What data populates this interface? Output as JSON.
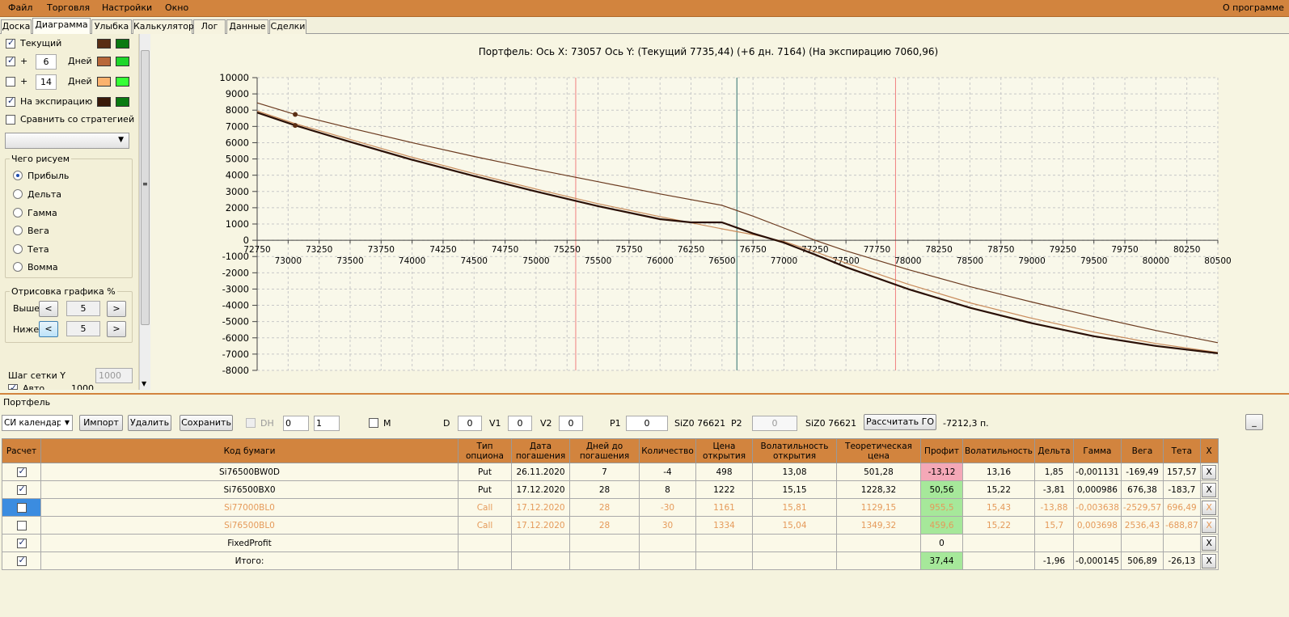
{
  "menu": {
    "file": "Файл",
    "trade": "Торговля",
    "settings": "Настройки",
    "window": "Окно",
    "about": "О программе"
  },
  "tabs": [
    "Доска",
    "Диаграмма",
    "Улыбка",
    "Калькулятор",
    "Лог",
    "Данные",
    "Сделки"
  ],
  "left": {
    "current": "Текущий",
    "plus": "+",
    "days": "Дней",
    "days1": "6",
    "days2": "14",
    "expiry": "На экспирацию",
    "compare": "Сравнить со стратегией",
    "whatdraw": "Чего рисуем",
    "radios": [
      "Прибыль",
      "Дельта",
      "Гамма",
      "Вега",
      "Тета",
      "Вомма"
    ],
    "drawpct": "Отрисовка графика %",
    "above": "Выше",
    "below": "Ниже",
    "above_val": "5",
    "below_val": "5",
    "lt": "<",
    "gt": ">",
    "gridstep": "Шаг сетки Y",
    "gridstep_val": "1000",
    "auto": "Авто",
    "auto_val": "1000"
  },
  "colors": {
    "current_a": "#5a2e14",
    "current_b": "#0a7a12",
    "plus_a": "#b8683a",
    "plus_b": "#1ed62a",
    "plus2_a": "#fbb26e",
    "plus2_b": "#35ff35",
    "exp_a": "#3a1a0a",
    "exp_b": "#0a7a12"
  },
  "chart_data": {
    "type": "line",
    "title": "Портфель: Ось X: 73057 Ось Y:  (Текущий 7735,44)  (+6 дн. 7164)  (На экспирацию 7060,96)",
    "xlim": [
      72750,
      80500
    ],
    "ylim": [
      -8000,
      10000
    ],
    "xticks_top": [
      72750,
      73250,
      73750,
      74250,
      74750,
      75250,
      75750,
      76250,
      76750,
      77250,
      77750,
      78250,
      78750,
      79250,
      79750,
      80250
    ],
    "xticks_bottom": [
      73000,
      73500,
      74000,
      74500,
      75000,
      75500,
      76000,
      76500,
      77000,
      77500,
      78000,
      78500,
      79000,
      79500,
      80000,
      80500
    ],
    "yticks": [
      10000,
      9000,
      8000,
      7000,
      6000,
      5000,
      4000,
      3000,
      2000,
      1000,
      0,
      -1000,
      -2000,
      -3000,
      -4000,
      -5000,
      -6000,
      -7000,
      -8000
    ],
    "vlines": [
      {
        "x": 75320,
        "color": "#f08080"
      },
      {
        "x": 76620,
        "color": "#2f6f6f"
      },
      {
        "x": 77900,
        "color": "#f08080"
      }
    ],
    "markers": [
      {
        "x": 73057,
        "y": 7735
      },
      {
        "x": 73057,
        "y": 7060
      }
    ],
    "series": [
      {
        "color": "#6b3a1f",
        "width": 1.2,
        "points": [
          [
            72750,
            8450
          ],
          [
            73057,
            7735
          ],
          [
            73500,
            6900
          ],
          [
            74000,
            6000
          ],
          [
            74500,
            5150
          ],
          [
            75000,
            4350
          ],
          [
            75500,
            3600
          ],
          [
            76000,
            2850
          ],
          [
            76500,
            2150
          ],
          [
            76750,
            1480
          ],
          [
            77000,
            750
          ],
          [
            77250,
            0
          ],
          [
            77500,
            -650
          ],
          [
            78000,
            -1800
          ],
          [
            78500,
            -2850
          ],
          [
            79000,
            -3800
          ],
          [
            79500,
            -4700
          ],
          [
            80000,
            -5550
          ],
          [
            80500,
            -6300
          ]
        ]
      },
      {
        "color": "#c88a5a",
        "width": 1.2,
        "points": [
          [
            72750,
            7950
          ],
          [
            73057,
            7164
          ],
          [
            73500,
            6200
          ],
          [
            74000,
            5100
          ],
          [
            74500,
            4100
          ],
          [
            75000,
            3150
          ],
          [
            75500,
            2250
          ],
          [
            76000,
            1450
          ],
          [
            76500,
            700
          ],
          [
            76750,
            350
          ],
          [
            77000,
            -80
          ],
          [
            77250,
            -700
          ],
          [
            77500,
            -1400
          ],
          [
            78000,
            -2700
          ],
          [
            78500,
            -3850
          ],
          [
            79000,
            -4800
          ],
          [
            79500,
            -5650
          ],
          [
            80000,
            -6350
          ],
          [
            80500,
            -6900
          ]
        ]
      },
      {
        "color": "#2a0f05",
        "width": 2.2,
        "points": [
          [
            72750,
            7850
          ],
          [
            73057,
            7060
          ],
          [
            73500,
            6050
          ],
          [
            74000,
            4950
          ],
          [
            74500,
            3950
          ],
          [
            75000,
            3000
          ],
          [
            75500,
            2100
          ],
          [
            76000,
            1300
          ],
          [
            76250,
            1100
          ],
          [
            76500,
            1100
          ],
          [
            76750,
            420
          ],
          [
            77000,
            -150
          ],
          [
            77250,
            -880
          ],
          [
            77500,
            -1650
          ],
          [
            78000,
            -3000
          ],
          [
            78500,
            -4150
          ],
          [
            79000,
            -5100
          ],
          [
            79500,
            -5900
          ],
          [
            80000,
            -6500
          ],
          [
            80500,
            -6950
          ]
        ]
      }
    ]
  },
  "portfolio": {
    "title": "Портфель",
    "combo": "СИ календарь",
    "import": "Импорт",
    "delete": "Удалить",
    "save": "Сохранить",
    "dh": "DH",
    "dh1": "0",
    "dh2": "1",
    "m": "M",
    "d": "D",
    "d_val": "0",
    "v1": "V1",
    "v1_val": "0",
    "v2": "V2",
    "v2_val": "0",
    "p1": "P1",
    "p1_val": "0",
    "p1_sym": "SiZ0 76621",
    "p2": "P2",
    "p2_val": "0",
    "p2_sym": "SiZ0 76621",
    "calc_go": "Рассчитать ГО",
    "go_val": "-7212,3 п.",
    "min": "_"
  },
  "table": {
    "headers": [
      "Расчет",
      "Код бумаги",
      "Тип опциона",
      "Дата погашения",
      "Дней до погашения",
      "Количество",
      "Цена открытия",
      "Волатильность открытия",
      "Теоретическая цена",
      "Профит",
      "Волатильность",
      "Дельта",
      "Гамма",
      "Вега",
      "Тета",
      "X"
    ],
    "rows": [
      {
        "checked": true,
        "code": "Si76500BW0D",
        "type": "Put",
        "date": "26.11.2020",
        "days": "7",
        "qty": "-4",
        "price": "498",
        "vol_open": "13,08",
        "theo": "501,28",
        "profit": "-13,12",
        "vol": "13,16",
        "delta": "1,85",
        "gamma": "-0,001131",
        "vega": "-169,49",
        "theta": "157,57",
        "cls": "",
        "pcls": "pink"
      },
      {
        "checked": true,
        "code": "Si76500BX0",
        "type": "Put",
        "date": "17.12.2020",
        "days": "28",
        "qty": "8",
        "price": "1222",
        "vol_open": "15,15",
        "theo": "1228,32",
        "profit": "50,56",
        "vol": "15,22",
        "delta": "-3,81",
        "gamma": "0,000986",
        "vega": "676,38",
        "theta": "-183,7",
        "cls": "",
        "pcls": "green"
      },
      {
        "checked": false,
        "code": "Si77000BL0",
        "type": "Call",
        "date": "17.12.2020",
        "days": "28",
        "qty": "-30",
        "price": "1161",
        "vol_open": "15,81",
        "theo": "1129,15",
        "profit": "955,5",
        "vol": "15,43",
        "delta": "-13,88",
        "gamma": "-0,003638",
        "vega": "-2529,57",
        "theta": "696,49",
        "cls": "orange",
        "pcls": "green",
        "sel": true
      },
      {
        "checked": false,
        "code": "Si76500BL0",
        "type": "Call",
        "date": "17.12.2020",
        "days": "28",
        "qty": "30",
        "price": "1334",
        "vol_open": "15,04",
        "theo": "1349,32",
        "profit": "459,6",
        "vol": "15,22",
        "delta": "15,7",
        "gamma": "0,003698",
        "vega": "2536,43",
        "theta": "-688,87",
        "cls": "orange",
        "pcls": "green"
      },
      {
        "checked": true,
        "code": "FixedProfit",
        "type": "",
        "date": "",
        "days": "",
        "qty": "",
        "price": "",
        "vol_open": "",
        "theo": "",
        "profit": "0",
        "vol": "",
        "delta": "",
        "gamma": "",
        "vega": "",
        "theta": "",
        "cls": "",
        "pcls": ""
      },
      {
        "checked": true,
        "code": "Итого:",
        "type": "",
        "date": "",
        "days": "",
        "qty": "",
        "price": "",
        "vol_open": "",
        "theo": "",
        "profit": "37,44",
        "vol": "",
        "delta": "-1,96",
        "gamma": "-0,000145",
        "vega": "506,89",
        "theta": "-26,13",
        "cls": "",
        "pcls": "green"
      }
    ]
  }
}
